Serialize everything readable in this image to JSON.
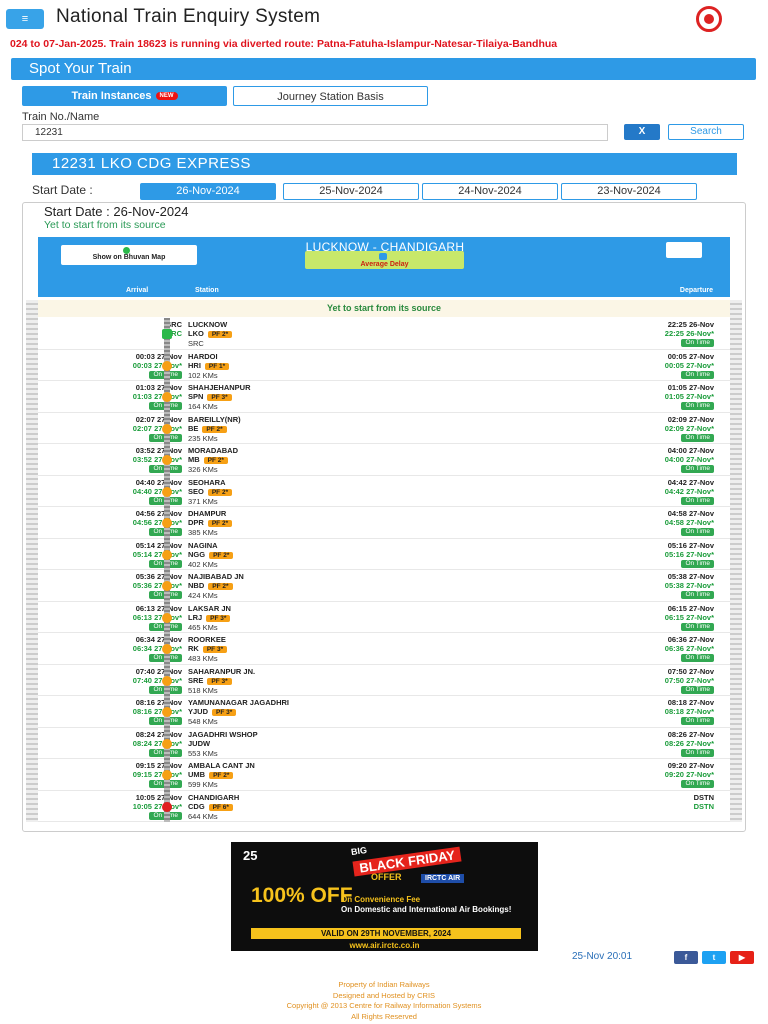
{
  "header": {
    "title": "National Train Enquiry System",
    "menu_icon": "≡"
  },
  "ticker": "024 to 07-Jan-2025. Train 18623 is running via diverted route: Patna-Fatuha-Islampur-Natesar-Tilaiya-Bandhua",
  "section_title": "Spot Your Train",
  "tabs": {
    "instances": "Train Instances",
    "new_badge": "NEW",
    "journey": "Journey Station Basis"
  },
  "search": {
    "label": "Train No./Name",
    "value": "12231",
    "clear": "X",
    "search": "Search"
  },
  "train_title": "12231 LKO CDG EXPRESS",
  "start_date_label": "Start Date :",
  "dates": [
    "26-Nov-2024",
    "25-Nov-2024",
    "24-Nov-2024",
    "23-Nov-2024"
  ],
  "info": {
    "start": "Start Date : 26-Nov-2024",
    "status": "Yet to start from its source"
  },
  "route": {
    "name": "LUCKNOW - CHANDIGARH",
    "bhuvan": "Show on Bhuvan Map",
    "avg_delay": "Average Delay",
    "col_arrival": "Arrival",
    "col_station": "Station",
    "col_departure": "Departure",
    "yet_row": "Yet to start from its source"
  },
  "stations": [
    {
      "arr1": "SRC",
      "arr2": "SRC",
      "ot": "",
      "name": "LUCKNOW",
      "code": "LKO",
      "pf": "PF 2*",
      "dist": "SRC",
      "dep1": "22:25 26-Nov",
      "dep2": "22:25 26-Nov*",
      "dot": "On Time"
    },
    {
      "arr1": "00:03 27-Nov",
      "arr2": "00:03 27-Nov*",
      "ot": "On Time",
      "name": "HARDOI",
      "code": "HRI",
      "pf": "PF 1*",
      "dist": "102 KMs",
      "dep1": "00:05 27-Nov",
      "dep2": "00:05 27-Nov*",
      "dot": "On Time"
    },
    {
      "arr1": "01:03 27-Nov",
      "arr2": "01:03 27-Nov*",
      "ot": "On Time",
      "name": "SHAHJEHANPUR",
      "code": "SPN",
      "pf": "PF 3*",
      "dist": "164 KMs",
      "dep1": "01:05 27-Nov",
      "dep2": "01:05 27-Nov*",
      "dot": "On Time"
    },
    {
      "arr1": "02:07 27-Nov",
      "arr2": "02:07 27-Nov*",
      "ot": "On Time",
      "name": "BAREILLY(NR)",
      "code": "BE",
      "pf": "PF 2*",
      "dist": "235 KMs",
      "dep1": "02:09 27-Nov",
      "dep2": "02:09 27-Nov*",
      "dot": "On Time"
    },
    {
      "arr1": "03:52 27-Nov",
      "arr2": "03:52 27-Nov*",
      "ot": "On Time",
      "name": "MORADABAD",
      "code": "MB",
      "pf": "PF 2*",
      "dist": "326 KMs",
      "dep1": "04:00 27-Nov",
      "dep2": "04:00 27-Nov*",
      "dot": "On Time"
    },
    {
      "arr1": "04:40 27-Nov",
      "arr2": "04:40 27-Nov*",
      "ot": "On Time",
      "name": "SEOHARA",
      "code": "SEO",
      "pf": "PF 2*",
      "dist": "371 KMs",
      "dep1": "04:42 27-Nov",
      "dep2": "04:42 27-Nov*",
      "dot": "On Time"
    },
    {
      "arr1": "04:56 27-Nov",
      "arr2": "04:56 27-Nov*",
      "ot": "On Time",
      "name": "DHAMPUR",
      "code": "DPR",
      "pf": "PF 2*",
      "dist": "385 KMs",
      "dep1": "04:58 27-Nov",
      "dep2": "04:58 27-Nov*",
      "dot": "On Time"
    },
    {
      "arr1": "05:14 27-Nov",
      "arr2": "05:14 27-Nov*",
      "ot": "On Time",
      "name": "NAGINA",
      "code": "NGG",
      "pf": "PF 2*",
      "dist": "402 KMs",
      "dep1": "05:16 27-Nov",
      "dep2": "05:16 27-Nov*",
      "dot": "On Time"
    },
    {
      "arr1": "05:36 27-Nov",
      "arr2": "05:36 27-Nov*",
      "ot": "On Time",
      "name": "NAJIBABAD JN",
      "code": "NBD",
      "pf": "PF 2*",
      "dist": "424 KMs",
      "dep1": "05:38 27-Nov",
      "dep2": "05:38 27-Nov*",
      "dot": "On Time"
    },
    {
      "arr1": "06:13 27-Nov",
      "arr2": "06:13 27-Nov*",
      "ot": "On Time",
      "name": "LAKSAR JN",
      "code": "LRJ",
      "pf": "PF 3*",
      "dist": "465 KMs",
      "dep1": "06:15 27-Nov",
      "dep2": "06:15 27-Nov*",
      "dot": "On Time"
    },
    {
      "arr1": "06:34 27-Nov",
      "arr2": "06:34 27-Nov*",
      "ot": "On Time",
      "name": "ROORKEE",
      "code": "RK",
      "pf": "PF 3*",
      "dist": "483 KMs",
      "dep1": "06:36 27-Nov",
      "dep2": "06:36 27-Nov*",
      "dot": "On Time"
    },
    {
      "arr1": "07:40 27-Nov",
      "arr2": "07:40 27-Nov*",
      "ot": "On Time",
      "name": "SAHARANPUR JN.",
      "code": "SRE",
      "pf": "PF 3*",
      "dist": "518 KMs",
      "dep1": "07:50 27-Nov",
      "dep2": "07:50 27-Nov*",
      "dot": "On Time"
    },
    {
      "arr1": "08:16 27-Nov",
      "arr2": "08:16 27-Nov*",
      "ot": "On Time",
      "name": "YAMUNANAGAR JAGADHRI",
      "code": "YJUD",
      "pf": "PF 3*",
      "dist": "548 KMs",
      "dep1": "08:18 27-Nov",
      "dep2": "08:18 27-Nov*",
      "dot": "On Time"
    },
    {
      "arr1": "08:24 27-Nov",
      "arr2": "08:24 27-Nov*",
      "ot": "On Time",
      "name": "JAGADHRI WSHOP",
      "code": "JUDW",
      "pf": "",
      "dist": "553 KMs",
      "dep1": "08:26 27-Nov",
      "dep2": "08:26 27-Nov*",
      "dot": "On Time"
    },
    {
      "arr1": "09:15 27-Nov",
      "arr2": "09:15 27-Nov*",
      "ot": "On Time",
      "name": "AMBALA CANT JN",
      "code": "UMB",
      "pf": "PF 2*",
      "dist": "599 KMs",
      "dep1": "09:20 27-Nov",
      "dep2": "09:20 27-Nov*",
      "dot": "On Time"
    },
    {
      "arr1": "10:05 27-Nov",
      "arr2": "10:05 27-Nov*",
      "ot": "On Time",
      "name": "CHANDIGARH",
      "code": "CDG",
      "pf": "PF 6*",
      "dist": "644 KMs",
      "dep1": "DSTN",
      "dep2": "DSTN",
      "dot": ""
    }
  ],
  "ad": {
    "logo": "25",
    "big": "BIG",
    "black_friday": "BLACK FRIDAY",
    "offer": "OFFER",
    "irctc_air": "IRCTC AIR",
    "pct": "100% OFF",
    "conv": "On Convenience Fee",
    "dom": "On Domestic and International Air Bookings!",
    "valid": "VALID ON 29TH NOVEMBER, 2024",
    "url": "www.air.irctc.co.in"
  },
  "timestamp": "25-Nov 20:01",
  "social": {
    "fb": "f",
    "tw": "t",
    "yt": "▶"
  },
  "footer": [
    "Property of Indian Railways",
    "Designed and Hosted by CRIS",
    "Copyright @ 2013 Centre for Railway Information Systems",
    "All Rights Reserved"
  ]
}
